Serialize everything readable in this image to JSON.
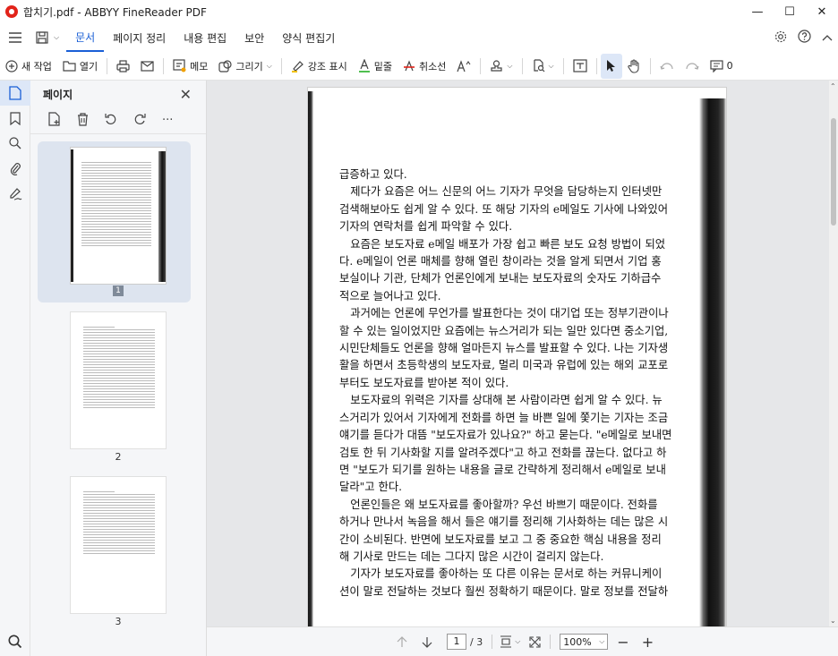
{
  "window": {
    "title": "합치기.pdf - ABBYY FineReader PDF",
    "minimize": "—",
    "maximize": "☐",
    "close": "✕"
  },
  "menu": {
    "items": [
      "문서",
      "페이지 정리",
      "내용 편집",
      "보안",
      "양식 편집기"
    ],
    "active": "문서"
  },
  "toolbar": {
    "new_task": "새 작업",
    "open": "열기",
    "note": "메모",
    "draw": "그리기",
    "highlight": "강조 표시",
    "underline": "밑줄",
    "strikethrough": "취소선",
    "comments_count": "0"
  },
  "panel": {
    "title": "페이지",
    "thumbnails": [
      {
        "label": "1",
        "selected": true
      },
      {
        "label": "2",
        "selected": false
      },
      {
        "label": "3",
        "selected": false
      }
    ]
  },
  "document": {
    "paragraphs": [
      "급증하고 있다.",
      "　제다가 요즘은 어느 신문의 어느 기자가 무엇을 담당하는지 인터넷만",
      "검색해보아도 쉽게 알 수 있다. 또 해당 기자의 e메일도 기사에 나와있어",
      "기자의 연락처를 쉽게 파악할 수 있다.",
      "　요즘은 보도자료 e메일 배포가 가장 쉽고 빠른 보도 요청 방법이 되었",
      "다. e메일이 언론 매체를 향해 열린 창이라는 것을 알게 되면서 기업 홍",
      "보실이나 기관, 단체가 언론인에게 보내는 보도자료의 숫자도 기하급수",
      "적으로 늘어나고 있다.",
      "　과거에는 언론에 무언가를 발표한다는 것이 대기업 또는 정부기관이나",
      "할 수 있는 일이었지만 요즘에는 뉴스거리가 되는 일만 있다면 중소기업,",
      "시민단체들도 언론을 향해 얼마든지 뉴스를 발표할 수 있다. 나는 기자생",
      "활을 하면서 초등학생의 보도자료, 멀리 미국과 유럽에 있는 해외 교포로",
      "부터도 보도자료를 받아본 적이 있다.",
      "　보도자료의 위력은 기자를 상대해 본 사람이라면 쉽게 알 수 있다. 뉴",
      "스거리가 있어서 기자에게 전화를 하면 늘 바쁜 일에 쫓기는 기자는 조금",
      "얘기를 듣다가 대뜸 \"보도자료가 있나요?\" 하고 묻는다. \"e메일로 보내면",
      "검토 한 뒤 기사화할 지를 알려주겠다\"고 하고 전화를 끊는다. 없다고 하",
      "면 \"보도가 되기를 원하는 내용을 글로 간략하게 정리해서 e메일로 보내",
      "달라\"고 한다.",
      "　언론인들은 왜 보도자료를 좋아할까? 우선 바쁘기 때문이다. 전화를",
      "하거나 만나서 녹음을 해서 들은 얘기를 정리해 기사화하는 데는 많은 시",
      "간이 소비된다. 반면에 보도자료를 보고 그 중 중요한 핵심 내용을 정리",
      "해 기사로 만드는 데는 그다지 많은 시간이 걸리지 않는다.",
      "　기자가 보도자료를 좋아하는 또 다른 이유는 문서로 하는 커뮤니케이",
      "션이 말로 전달하는 것보다 훨씬 정확하기 때문이다. 말로 정보를 전달하"
    ]
  },
  "status": {
    "current_page": "1",
    "total_pages": "/ 3",
    "zoom": "100%"
  },
  "colors": {
    "accent": "#1a5fd6",
    "brand": "#e2231a",
    "highlight_underline": "#3db83d",
    "strike": "#e2231a"
  }
}
